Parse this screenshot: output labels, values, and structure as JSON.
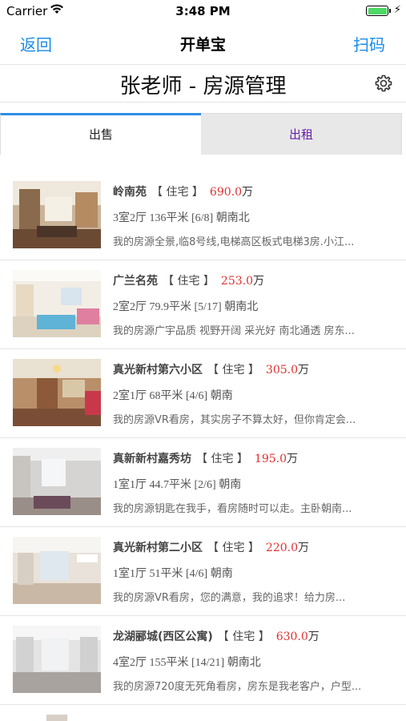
{
  "status_bar": {
    "carrier": "Carrier",
    "time": "3:48 PM"
  },
  "nav": {
    "back_label": "返回",
    "title": "开单宝",
    "scan_label": "扫码"
  },
  "page": {
    "heading": "张老师 - 房源管理"
  },
  "tabs": [
    {
      "label": "出售",
      "active": true
    },
    {
      "label": "出租",
      "active": false
    }
  ],
  "listings": [
    {
      "name": "岭南苑",
      "type": "【 住宅 】",
      "price": "690.0",
      "unit": "万",
      "details": "3室2厅 136平米 [6/8] 朝南北",
      "desc": "我的房源全景,临8号线,电梯高区板式电梯3房.小江..."
    },
    {
      "name": "广兰名苑",
      "type": "【 住宅 】",
      "price": "253.0",
      "unit": "万",
      "details": "2室2厅 79.9平米 [5/17] 朝南北",
      "desc": "我的房源广宇品质 视野开阔 采光好 南北通透 房东..."
    },
    {
      "name": "真光新村第六小区",
      "type": "【 住宅 】",
      "price": "305.0",
      "unit": "万",
      "details": "2室1厅 68平米 [4/6] 朝南",
      "desc": "我的房源VR看房，其实房子不算太好，但你肯定会..."
    },
    {
      "name": "真新新村嘉秀坊",
      "type": "【 住宅 】",
      "price": "195.0",
      "unit": "万",
      "details": "1室1厅 44.7平米 [2/6] 朝南",
      "desc": "我的房源钥匙在我手，看房随时可以走。主卧朝南..."
    },
    {
      "name": "真光新村第二小区",
      "type": "【 住宅 】",
      "price": "220.0",
      "unit": "万",
      "details": "1室1厅 51平米 [4/6] 朝南",
      "desc": "我的房源VR看房，您的满意，我的追求！给力房..."
    },
    {
      "name": "龙湖郦城(西区公寓)",
      "type": "【 住宅 】",
      "price": "630.0",
      "unit": "万",
      "details": "4室2厅 155平米 [14/21] 朝南北",
      "desc": "我的房源720度无死角看房，房东是我老客户，户型..."
    }
  ]
}
